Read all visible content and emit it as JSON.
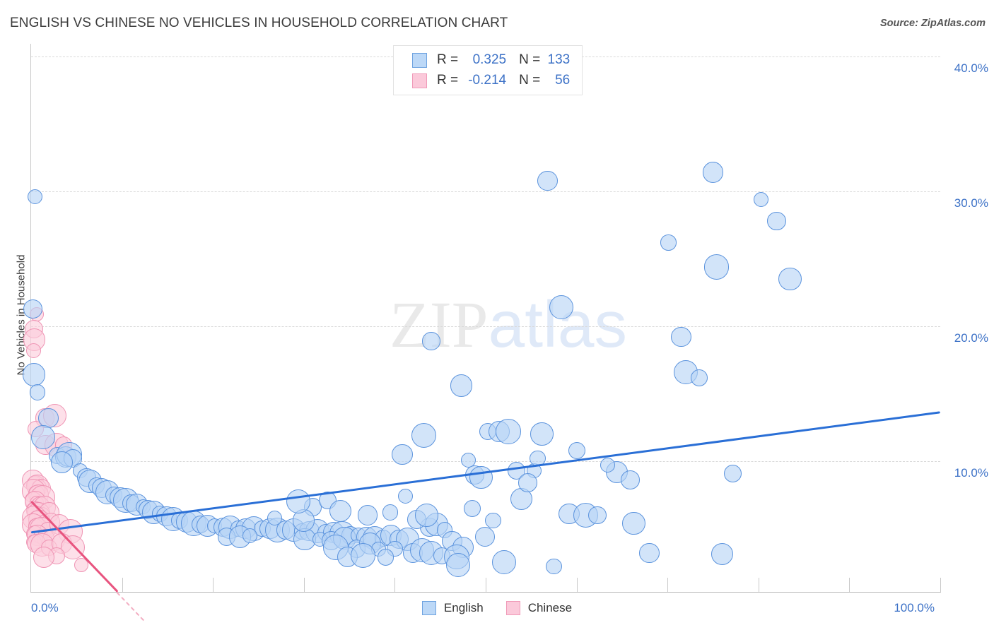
{
  "header": {
    "title": "ENGLISH VS CHINESE NO VEHICLES IN HOUSEHOLD CORRELATION CHART",
    "source": "Source: ZipAtlas.com"
  },
  "watermark": {
    "part1": "ZIP",
    "part2": "atlas"
  },
  "stats_legend": {
    "rows": [
      {
        "series": "English",
        "r_label": "R =",
        "r_value": "0.325",
        "n_label": "N =",
        "n_value": "133",
        "color": "#bcd8f7"
      },
      {
        "series": "Chinese",
        "r_label": "R =",
        "r_value": "-0.214",
        "n_label": "N =",
        "n_value": "56",
        "color": "#fbc9da"
      }
    ]
  },
  "bottom_legend": {
    "items": [
      {
        "label": "English",
        "color": "#bcd8f7"
      },
      {
        "label": "Chinese",
        "color": "#fbc9da"
      }
    ]
  },
  "chart_data": {
    "type": "scatter",
    "title": "ENGLISH VS CHINESE NO VEHICLES IN HOUSEHOLD CORRELATION CHART",
    "xlabel": "",
    "ylabel": "No Vehicles in Household",
    "xlim": [
      0,
      100
    ],
    "ylim": [
      0,
      41.6
    ],
    "xtick_labels": [
      "0.0%",
      "100.0%"
    ],
    "ytick_labels": [
      "10.0%",
      "20.0%",
      "30.0%",
      "40.0%"
    ],
    "yticks": [
      10,
      20,
      30,
      40
    ],
    "grid": "horizontal-dashed",
    "legend_position": "bottom-center",
    "series": [
      {
        "name": "English",
        "color": "#bcd8f7",
        "stroke": "#5b93dd",
        "r": 0.325,
        "n": 133,
        "trendline": {
          "x0": 0,
          "y0": 4.7,
          "x1": 100,
          "y1": 13.6
        },
        "points": [
          [
            0.4,
            29.6
          ],
          [
            0.2,
            21.3
          ],
          [
            0.3,
            16.4
          ],
          [
            0.7,
            15.1
          ],
          [
            1.9,
            13.2
          ],
          [
            1.3,
            11.8
          ],
          [
            2.9,
            10.4
          ],
          [
            3.8,
            10.3
          ],
          [
            4.2,
            10.5
          ],
          [
            4.6,
            10.2
          ],
          [
            3.4,
            9.9
          ],
          [
            5.4,
            9.3
          ],
          [
            6.1,
            8.8
          ],
          [
            6.5,
            8.5
          ],
          [
            7.2,
            8.2
          ],
          [
            7.8,
            8.0
          ],
          [
            8.4,
            7.7
          ],
          [
            9.1,
            7.5
          ],
          [
            9.8,
            7.3
          ],
          [
            10.4,
            7.1
          ],
          [
            11.0,
            6.9
          ],
          [
            11.6,
            6.8
          ],
          [
            12.3,
            6.6
          ],
          [
            12.9,
            6.4
          ],
          [
            13.5,
            6.2
          ],
          [
            14.2,
            6.1
          ],
          [
            14.9,
            5.9
          ],
          [
            15.6,
            5.7
          ],
          [
            16.3,
            5.6
          ],
          [
            17.1,
            5.5
          ],
          [
            17.9,
            5.4
          ],
          [
            18.6,
            5.3
          ],
          [
            19.4,
            5.2
          ],
          [
            20.2,
            5.2
          ],
          [
            21.1,
            5.1
          ],
          [
            21.9,
            5.1
          ],
          [
            22.8,
            5.0
          ],
          [
            23.6,
            5.0
          ],
          [
            24.5,
            5.0
          ],
          [
            25.4,
            5.0
          ],
          [
            26.3,
            5.0
          ],
          [
            27.1,
            4.9
          ],
          [
            21.5,
            4.4
          ],
          [
            23.0,
            4.4
          ],
          [
            24.1,
            4.5
          ],
          [
            28.0,
            4.9
          ],
          [
            28.9,
            4.9
          ],
          [
            29.8,
            4.8
          ],
          [
            30.6,
            4.8
          ],
          [
            31.5,
            4.8
          ],
          [
            32.4,
            4.7
          ],
          [
            33.3,
            4.7
          ],
          [
            34.2,
            4.6
          ],
          [
            35.1,
            4.5
          ],
          [
            30.1,
            4.2
          ],
          [
            31.8,
            4.2
          ],
          [
            33.0,
            4.1
          ],
          [
            34.5,
            4.3
          ],
          [
            36.0,
            4.5
          ],
          [
            36.9,
            4.4
          ],
          [
            37.8,
            4.3
          ],
          [
            38.7,
            4.3
          ],
          [
            39.6,
            4.5
          ],
          [
            33.5,
            3.6
          ],
          [
            35.8,
            3.5
          ],
          [
            37.3,
            3.9
          ],
          [
            38.2,
            3.5
          ],
          [
            40.5,
            4.2
          ],
          [
            41.4,
            4.2
          ],
          [
            40.0,
            3.5
          ],
          [
            42.0,
            3.2
          ],
          [
            43.0,
            3.4
          ],
          [
            39.0,
            2.9
          ],
          [
            34.8,
            2.9
          ],
          [
            36.5,
            3.0
          ],
          [
            31.0,
            6.6
          ],
          [
            30.0,
            5.6
          ],
          [
            26.8,
            5.8
          ],
          [
            43.8,
            5.1
          ],
          [
            44.6,
            5.3
          ],
          [
            45.5,
            4.9
          ],
          [
            46.3,
            4.1
          ],
          [
            44.0,
            3.2
          ],
          [
            45.2,
            3.0
          ],
          [
            47.5,
            3.6
          ],
          [
            46.8,
            2.9
          ],
          [
            32.6,
            7.1
          ],
          [
            34.0,
            6.3
          ],
          [
            41.2,
            7.4
          ],
          [
            42.4,
            5.7
          ],
          [
            43.5,
            6.0
          ],
          [
            39.5,
            6.2
          ],
          [
            37.0,
            6.0
          ],
          [
            29.4,
            7.0
          ],
          [
            48.5,
            6.5
          ],
          [
            40.8,
            10.5
          ],
          [
            43.2,
            11.9
          ],
          [
            44.0,
            18.9
          ],
          [
            47.3,
            15.6
          ],
          [
            48.1,
            10.1
          ],
          [
            48.8,
            9.0
          ],
          [
            49.5,
            8.8
          ],
          [
            50.8,
            5.6
          ],
          [
            49.9,
            4.4
          ],
          [
            47.0,
            2.3
          ],
          [
            50.2,
            12.2
          ],
          [
            51.5,
            12.2
          ],
          [
            52.5,
            12.2
          ],
          [
            53.4,
            9.3
          ],
          [
            53.9,
            7.2
          ],
          [
            55.3,
            9.3
          ],
          [
            54.6,
            8.4
          ],
          [
            56.2,
            12.0
          ],
          [
            55.7,
            10.2
          ],
          [
            56.8,
            30.8
          ],
          [
            58.3,
            21.4
          ],
          [
            60.0,
            10.8
          ],
          [
            59.2,
            6.1
          ],
          [
            61.0,
            6.0
          ],
          [
            62.3,
            6.0
          ],
          [
            64.4,
            9.2
          ],
          [
            63.4,
            9.7
          ],
          [
            65.9,
            8.6
          ],
          [
            66.3,
            5.4
          ],
          [
            70.1,
            26.2
          ],
          [
            71.5,
            19.2
          ],
          [
            72.0,
            16.6
          ],
          [
            73.5,
            16.2
          ],
          [
            75.0,
            31.4
          ],
          [
            75.4,
            24.4
          ],
          [
            77.2,
            9.1
          ],
          [
            76.0,
            3.1
          ],
          [
            80.3,
            29.4
          ],
          [
            82.0,
            27.8
          ],
          [
            83.5,
            23.5
          ],
          [
            57.5,
            2.2
          ],
          [
            68.0,
            3.2
          ],
          [
            52.0,
            2.5
          ]
        ]
      },
      {
        "name": "Chinese",
        "color": "#fbc9da",
        "stroke": "#ef94b4",
        "r": -0.214,
        "n": 56,
        "trendline": {
          "x0": 0,
          "y0": 7.0,
          "x1": 9.5,
          "y1": 0.3
        },
        "points": [
          [
            0.6,
            20.9
          ],
          [
            0.3,
            19.8
          ],
          [
            0.35,
            19.0
          ],
          [
            0.25,
            18.2
          ],
          [
            1.5,
            13.2
          ],
          [
            2.6,
            13.4
          ],
          [
            0.5,
            12.4
          ],
          [
            1.6,
            11.2
          ],
          [
            2.8,
            11.2
          ],
          [
            3.6,
            11.2
          ],
          [
            0.2,
            8.6
          ],
          [
            0.35,
            8.4
          ],
          [
            0.5,
            8.3
          ],
          [
            0.7,
            8.2
          ],
          [
            0.9,
            8.1
          ],
          [
            1.1,
            8.0
          ],
          [
            0.3,
            7.8
          ],
          [
            0.55,
            7.6
          ],
          [
            0.8,
            7.5
          ],
          [
            1.3,
            7.3
          ],
          [
            0.25,
            7.1
          ],
          [
            0.45,
            7.0
          ],
          [
            0.65,
            6.9
          ],
          [
            1.0,
            6.7
          ],
          [
            1.5,
            6.6
          ],
          [
            0.3,
            6.4
          ],
          [
            0.5,
            6.3
          ],
          [
            0.8,
            6.1
          ],
          [
            1.2,
            6.0
          ],
          [
            2.0,
            6.2
          ],
          [
            0.35,
            5.8
          ],
          [
            0.6,
            5.7
          ],
          [
            0.9,
            5.6
          ],
          [
            1.4,
            5.5
          ],
          [
            2.2,
            5.5
          ],
          [
            0.25,
            5.3
          ],
          [
            0.5,
            5.2
          ],
          [
            0.75,
            5.1
          ],
          [
            1.1,
            5.0
          ],
          [
            1.8,
            4.9
          ],
          [
            3.1,
            5.3
          ],
          [
            4.3,
            4.8
          ],
          [
            0.4,
            4.6
          ],
          [
            0.7,
            4.5
          ],
          [
            1.0,
            4.4
          ],
          [
            1.6,
            4.3
          ],
          [
            2.5,
            4.2
          ],
          [
            0.3,
            4.0
          ],
          [
            0.6,
            3.9
          ],
          [
            1.2,
            3.8
          ],
          [
            2.0,
            3.6
          ],
          [
            3.4,
            3.9
          ],
          [
            4.6,
            3.6
          ],
          [
            2.8,
            3.0
          ],
          [
            1.4,
            2.9
          ],
          [
            5.5,
            2.3
          ]
        ]
      }
    ]
  }
}
